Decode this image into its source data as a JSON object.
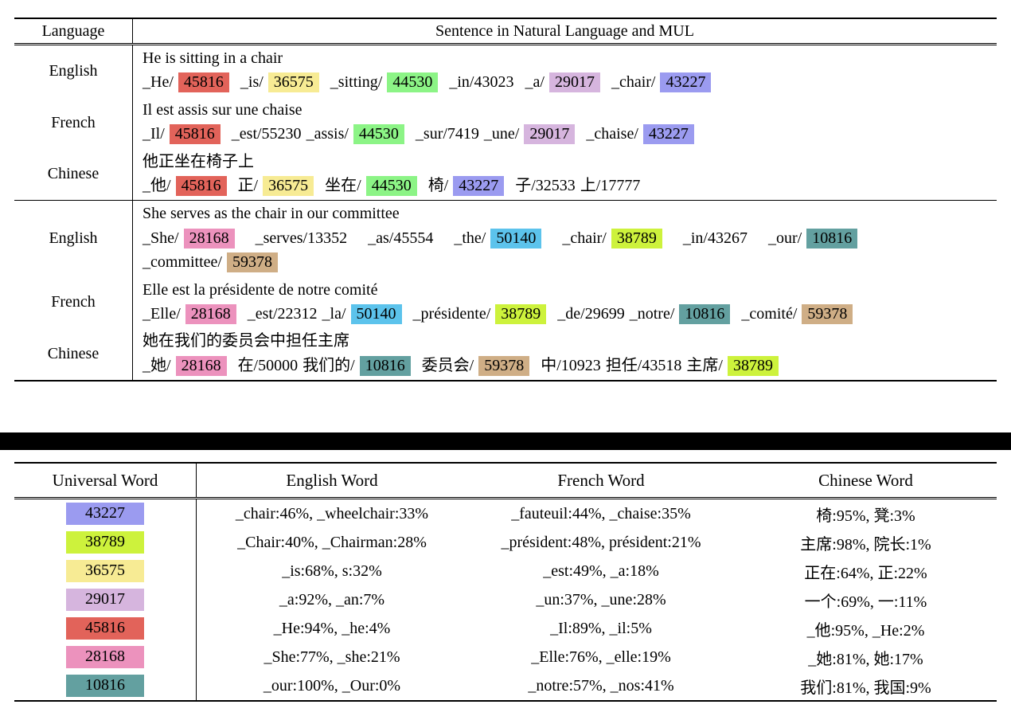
{
  "colors": {
    "c43227": "#9b9bf0",
    "c38789": "#cdf23c",
    "c36575": "#f7eb94",
    "c29017": "#d6b5de",
    "c45816": "#e2635a",
    "c28168": "#ec92bd",
    "c10816": "#63a0a0",
    "c44530": "#8cf486",
    "c50140": "#5cc3ec",
    "c59378": "#cfae86",
    "black_bar": "#000000"
  },
  "top_table": {
    "header": {
      "language": "Language",
      "sentence": "Sentence in Natural Language and MUL"
    },
    "groups": [
      {
        "rows": [
          {
            "language": "English",
            "natural": "He is sitting in a chair",
            "tokens": [
              {
                "text": "_He/",
                "hl": null,
                "gap": "s"
              },
              {
                "text": "45816",
                "hl": "c45816",
                "gap": "m"
              },
              {
                "text": "_is/",
                "hl": null,
                "gap": "s"
              },
              {
                "text": "36575",
                "hl": "c36575",
                "gap": "m"
              },
              {
                "text": "_sitting/",
                "hl": null,
                "gap": "s"
              },
              {
                "text": "44530",
                "hl": "c44530",
                "gap": "m"
              },
              {
                "text": "_in/43023",
                "hl": null,
                "gap": "m"
              },
              {
                "text": "_a/",
                "hl": null,
                "gap": "s"
              },
              {
                "text": "29017",
                "hl": "c29017",
                "gap": "m"
              },
              {
                "text": "_chair/",
                "hl": null,
                "gap": "s"
              },
              {
                "text": "43227",
                "hl": "c43227",
                "gap": "s"
              }
            ]
          },
          {
            "language": "French",
            "natural": "Il est assis sur une chaise",
            "tokens": [
              {
                "text": "_Il/",
                "hl": null,
                "gap": "s"
              },
              {
                "text": "45816",
                "hl": "c45816",
                "gap": "m"
              },
              {
                "text": "_est/55230",
                "hl": null,
                "gap": "s"
              },
              {
                "text": "_assis/",
                "hl": null,
                "gap": "s"
              },
              {
                "text": "44530",
                "hl": "c44530",
                "gap": "m"
              },
              {
                "text": "_sur/7419",
                "hl": null,
                "gap": "s"
              },
              {
                "text": "_une/",
                "hl": null,
                "gap": "s"
              },
              {
                "text": "29017",
                "hl": "c29017",
                "gap": "m"
              },
              {
                "text": "_chaise/",
                "hl": null,
                "gap": "s"
              },
              {
                "text": "43227",
                "hl": "c43227",
                "gap": "s"
              }
            ]
          },
          {
            "language": "Chinese",
            "natural": "他正坐在椅子上",
            "tokens": [
              {
                "text": "_他/",
                "hl": null,
                "gap": "s"
              },
              {
                "text": "45816",
                "hl": "c45816",
                "gap": "m"
              },
              {
                "text": "正/",
                "hl": null,
                "gap": "s"
              },
              {
                "text": "36575",
                "hl": "c36575",
                "gap": "m"
              },
              {
                "text": "坐在/",
                "hl": null,
                "gap": "s"
              },
              {
                "text": "44530",
                "hl": "c44530",
                "gap": "m"
              },
              {
                "text": "椅/",
                "hl": null,
                "gap": "s"
              },
              {
                "text": "43227",
                "hl": "c43227",
                "gap": "m"
              },
              {
                "text": "子/32533",
                "hl": null,
                "gap": "s"
              },
              {
                "text": "上/17777",
                "hl": null,
                "gap": "s"
              }
            ]
          }
        ]
      },
      {
        "rows": [
          {
            "language": "English",
            "natural": "She serves as the chair in our committee",
            "tokens": [
              {
                "text": "_She/",
                "hl": null,
                "gap": "s"
              },
              {
                "text": "28168",
                "hl": "c28168",
                "gap": "l"
              },
              {
                "text": "_serves/13352",
                "hl": null,
                "gap": "l"
              },
              {
                "text": "_as/45554",
                "hl": null,
                "gap": "l"
              },
              {
                "text": "_the/",
                "hl": null,
                "gap": "s"
              },
              {
                "text": "50140",
                "hl": "c50140",
                "gap": "l"
              },
              {
                "text": "_chair/",
                "hl": null,
                "gap": "s"
              },
              {
                "text": "38789",
                "hl": "c38789",
                "gap": "l"
              },
              {
                "text": "_in/43267",
                "hl": null,
                "gap": "l"
              },
              {
                "text": "_our/",
                "hl": null,
                "gap": "s"
              },
              {
                "text": "10816",
                "hl": "c10816",
                "gap": "s"
              }
            ],
            "tokens2": [
              {
                "text": "_committee/",
                "hl": null,
                "gap": "s"
              },
              {
                "text": "59378",
                "hl": "c59378",
                "gap": "s"
              }
            ]
          },
          {
            "language": "French",
            "natural": "Elle est la présidente de notre comité",
            "tokens": [
              {
                "text": "_Elle/",
                "hl": null,
                "gap": "s"
              },
              {
                "text": "28168",
                "hl": "c28168",
                "gap": "m"
              },
              {
                "text": "_est/22312",
                "hl": null,
                "gap": "s"
              },
              {
                "text": "_la/",
                "hl": null,
                "gap": "s"
              },
              {
                "text": "50140",
                "hl": "c50140",
                "gap": "m"
              },
              {
                "text": "_présidente/",
                "hl": null,
                "gap": "s"
              },
              {
                "text": "38789",
                "hl": "c38789",
                "gap": "m"
              },
              {
                "text": "_de/29699",
                "hl": null,
                "gap": "s"
              },
              {
                "text": "_notre/",
                "hl": null,
                "gap": "s"
              },
              {
                "text": "10816",
                "hl": "c10816",
                "gap": "m"
              },
              {
                "text": "_comité/",
                "hl": null,
                "gap": "s"
              },
              {
                "text": "59378",
                "hl": "c59378",
                "gap": "s"
              }
            ]
          },
          {
            "language": "Chinese",
            "natural": "她在我们的委员会中担任主席",
            "tokens": [
              {
                "text": "_她/",
                "hl": null,
                "gap": "s"
              },
              {
                "text": "28168",
                "hl": "c28168",
                "gap": "m"
              },
              {
                "text": "在/50000",
                "hl": null,
                "gap": "s"
              },
              {
                "text": "我们的/",
                "hl": null,
                "gap": "s"
              },
              {
                "text": "10816",
                "hl": "c10816",
                "gap": "m"
              },
              {
                "text": "委员会/",
                "hl": null,
                "gap": "s"
              },
              {
                "text": "59378",
                "hl": "c59378",
                "gap": "m"
              },
              {
                "text": "中/10923",
                "hl": null,
                "gap": "s"
              },
              {
                "text": "担任/43518",
                "hl": null,
                "gap": "s"
              },
              {
                "text": "主席/",
                "hl": null,
                "gap": "s"
              },
              {
                "text": "38789",
                "hl": "c38789",
                "gap": "s"
              }
            ]
          }
        ]
      }
    ]
  },
  "bottom_table": {
    "headers": {
      "universal": "Universal Word",
      "english": "English Word",
      "french": "French Word",
      "chinese": "Chinese Word"
    },
    "rows": [
      {
        "uw": "43227",
        "color": "c43227",
        "english": "_chair:46%, _wheelchair:33%",
        "french": "_fauteuil:44%, _chaise:35%",
        "chinese": "椅:95%, 凳:3%"
      },
      {
        "uw": "38789",
        "color": "c38789",
        "english": "_Chair:40%, _Chairman:28%",
        "french": "_président:48%, président:21%",
        "chinese": "主席:98%, 院长:1%"
      },
      {
        "uw": "36575",
        "color": "c36575",
        "english": "_is:68%, s:32%",
        "french": "_est:49%, _a:18%",
        "chinese": "正在:64%, 正:22%"
      },
      {
        "uw": "29017",
        "color": "c29017",
        "english": "_a:92%, _an:7%",
        "french": "_un:37%, _une:28%",
        "chinese": "一个:69%, 一:11%"
      },
      {
        "uw": "45816",
        "color": "c45816",
        "english": "_He:94%, _he:4%",
        "french": "_Il:89%, _il:5%",
        "chinese": "_他:95%, _He:2%"
      },
      {
        "uw": "28168",
        "color": "c28168",
        "english": "_She:77%, _she:21%",
        "french": "_Elle:76%, _elle:19%",
        "chinese": "_她:81%, 她:17%"
      },
      {
        "uw": "10816",
        "color": "c10816",
        "english": "_our:100%, _Our:0%",
        "french": "_notre:57%, _nos:41%",
        "chinese": "我们:81%, 我国:9%"
      }
    ]
  }
}
